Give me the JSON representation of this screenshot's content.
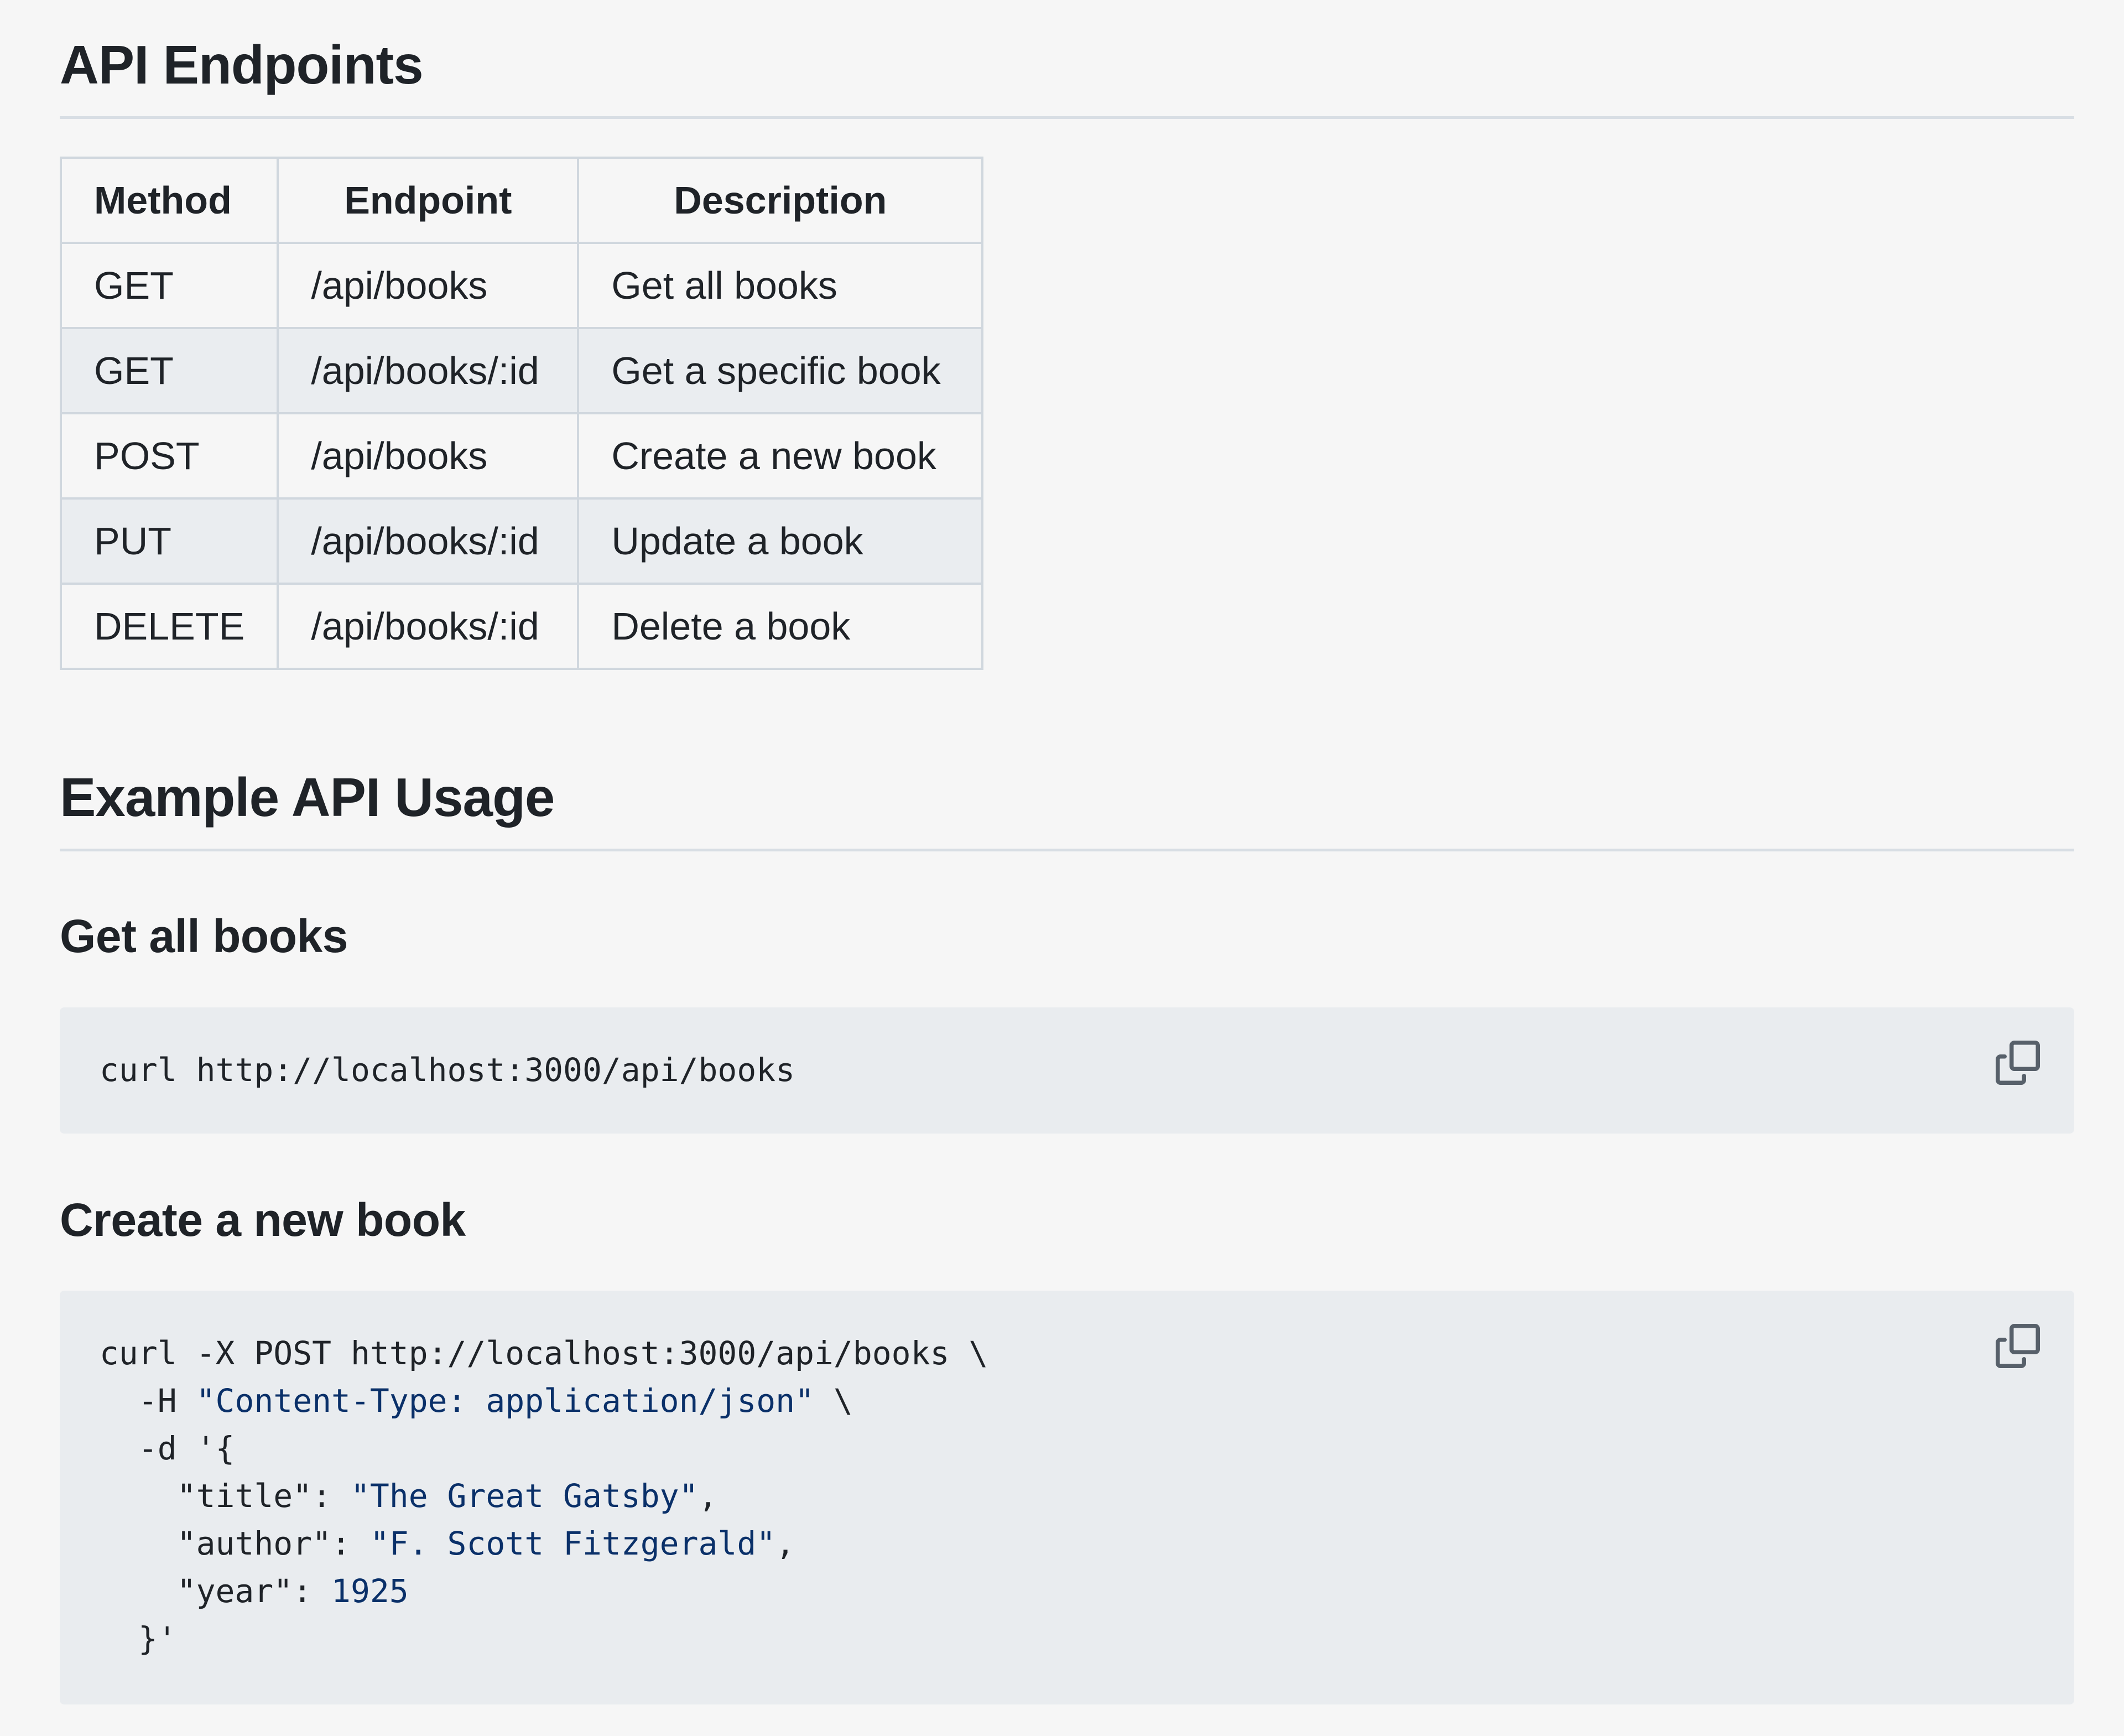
{
  "sections": {
    "endpoints_heading": "API Endpoints",
    "usage_heading": "Example API Usage"
  },
  "table": {
    "headers": [
      "Method",
      "Endpoint",
      "Description"
    ],
    "rows": [
      [
        "GET",
        "/api/books",
        "Get all books"
      ],
      [
        "GET",
        "/api/books/:id",
        "Get a specific book"
      ],
      [
        "POST",
        "/api/books",
        "Create a new book"
      ],
      [
        "PUT",
        "/api/books/:id",
        "Update a book"
      ],
      [
        "DELETE",
        "/api/books/:id",
        "Delete a book"
      ]
    ]
  },
  "examples": [
    {
      "heading": "Get all books",
      "code": "curl http://localhost:3000/api/books"
    },
    {
      "heading": "Create a new book",
      "code_lines": [
        "curl -X POST http://localhost:3000/api/books \\",
        "  -H \"Content-Type: application/json\" \\",
        "  -d '{",
        "    \"title\": \"The Great Gatsby\",",
        "    \"author\": \"F. Scott Fitzgerald\",",
        "    \"year\": 1925",
        "  }'"
      ]
    }
  ],
  "icons": {
    "copy": "copy-icon"
  },
  "colors": {
    "background": "#f6f6f6",
    "code_background": "#e9ecef",
    "table_border": "#d0d7de",
    "string_color": "#0a3069"
  }
}
